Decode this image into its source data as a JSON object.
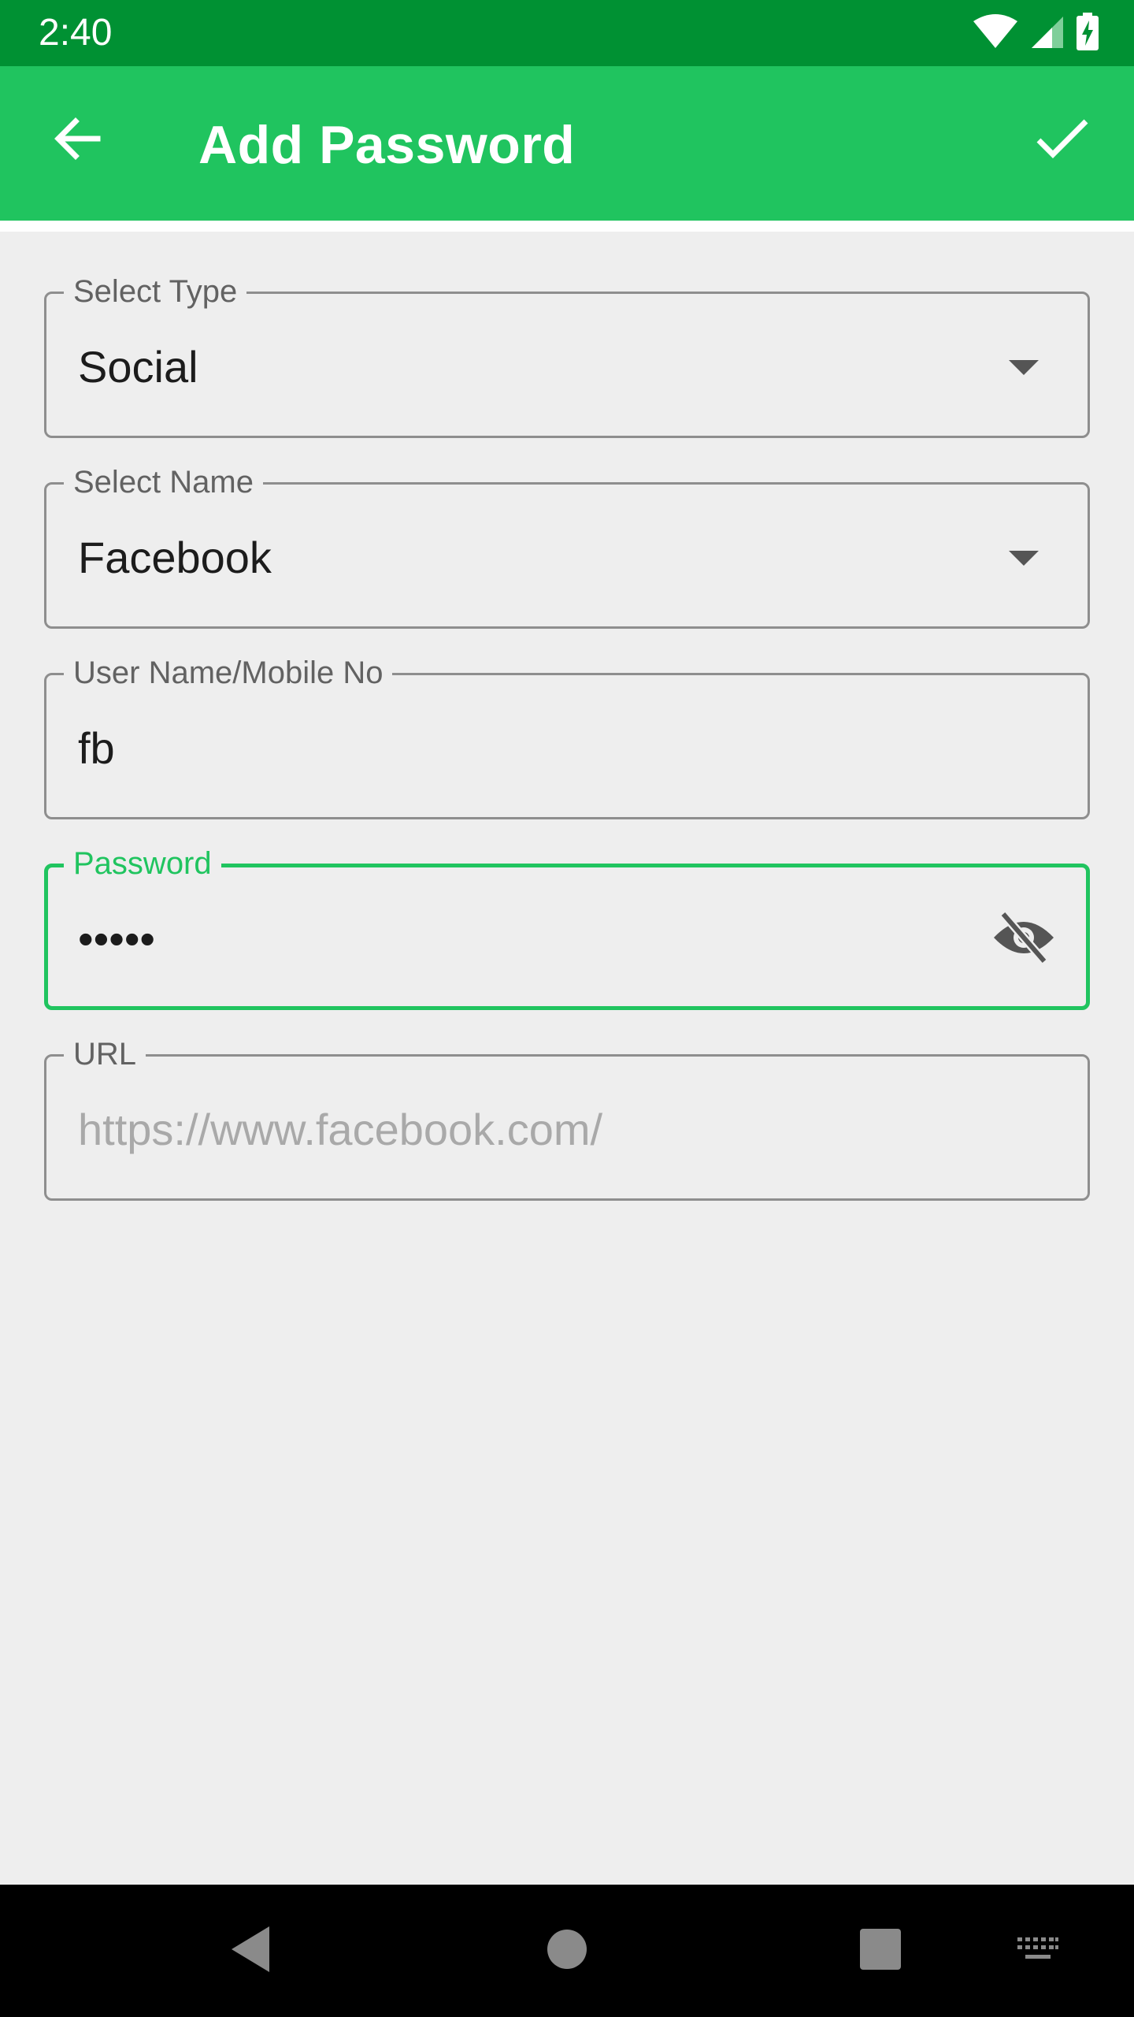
{
  "status_bar": {
    "time": "2:40",
    "icons": [
      "wifi-icon",
      "signal-icon",
      "battery-charging-icon"
    ]
  },
  "app_bar": {
    "title": "Add Password",
    "back_icon": "arrow-back-icon",
    "save_icon": "check-icon"
  },
  "form": {
    "type": {
      "label": "Select Type",
      "value": "Social"
    },
    "name": {
      "label": "Select Name",
      "value": "Facebook"
    },
    "username": {
      "label": "User Name/Mobile No",
      "value": "fb"
    },
    "password": {
      "label": "Password",
      "value": "•••••",
      "toggle_icon": "visibility-off-icon"
    },
    "url": {
      "label": "URL",
      "placeholder": "https://www.facebook.com/"
    }
  },
  "nav_bar": {
    "icons": [
      "nav-back-icon",
      "nav-home-icon",
      "nav-recents-icon",
      "keyboard-icon"
    ]
  },
  "colors": {
    "status_bar": "#009133",
    "app_bar": "#20c45f",
    "accent": "#20c45f",
    "background": "#eeeeee"
  }
}
